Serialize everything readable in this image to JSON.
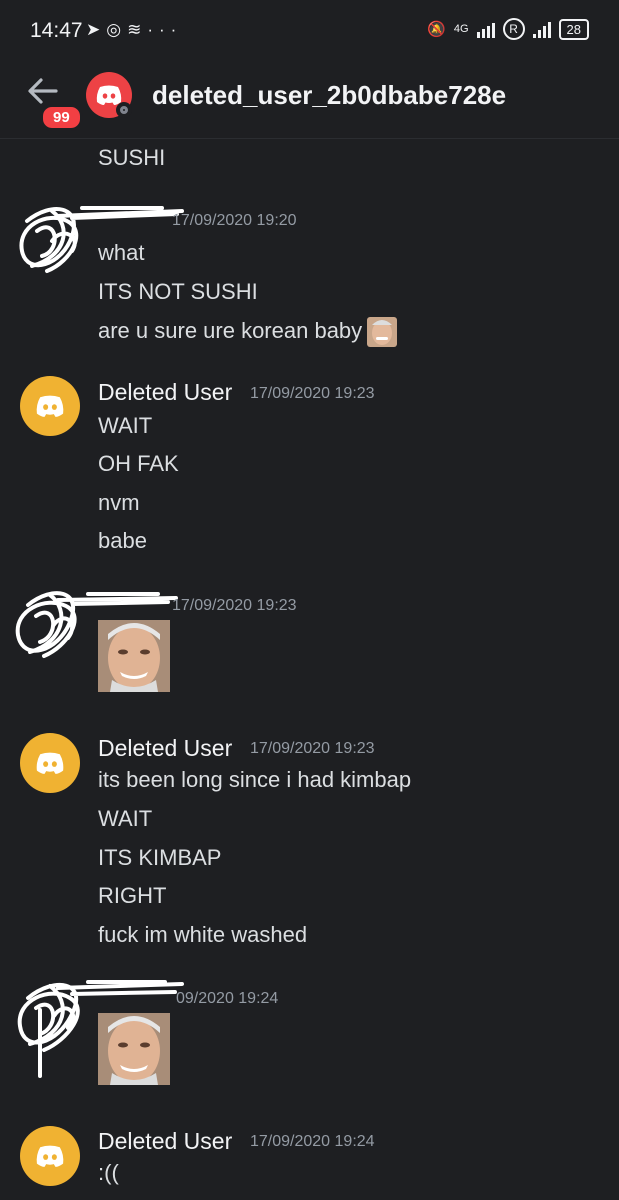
{
  "status_bar": {
    "time": "14:47",
    "network": "4G",
    "battery": "28",
    "icons": [
      "telegram-icon",
      "instagram-icon",
      "layers-icon",
      "more-icon",
      "mute-icon",
      "signal-icon",
      "registered-icon",
      "wifi-icon",
      "battery-icon"
    ]
  },
  "header": {
    "badge_count": "99",
    "title": "deleted_user_2b0dbabe728e",
    "avatar_color": "#ed4245"
  },
  "colors": {
    "background": "#1e1f22",
    "deleted_avatar": "#f0b232",
    "timestamp": "#949ba4"
  },
  "messages": {
    "top_line": "SUSHI",
    "g1": {
      "timestamp": "17/09/2020 19:20",
      "lines": [
        "what",
        "ITS NOT SUSHI",
        "are u sure ure korean baby"
      ]
    },
    "g2": {
      "author": "Deleted User",
      "timestamp": "17/09/2020 19:23",
      "lines": [
        "WAIT",
        "OH FAK",
        "nvm",
        "babe"
      ]
    },
    "g3": {
      "timestamp": "17/09/2020 19:23"
    },
    "g4": {
      "author": "Deleted User",
      "timestamp": "17/09/2020 19:23",
      "lines": [
        "its been long since i had kimbap",
        "WAIT",
        "ITS KIMBAP",
        "RIGHT",
        "fuck im white washed"
      ]
    },
    "g5": {
      "timestamp": "09/2020 19:24"
    },
    "g6": {
      "author": "Deleted User",
      "timestamp": "17/09/2020 19:24",
      "lines": [
        ":(("
      ]
    }
  }
}
